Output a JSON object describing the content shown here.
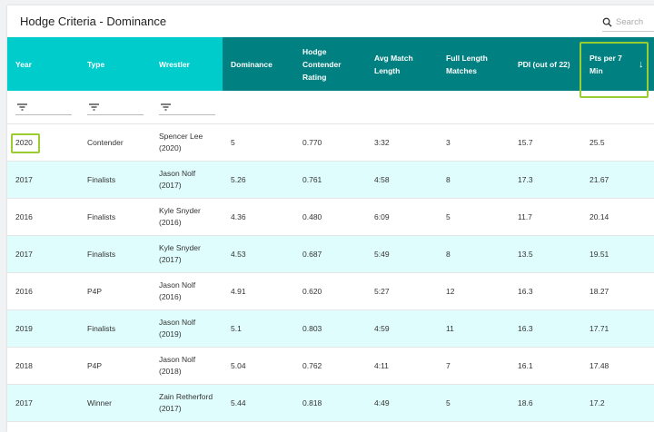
{
  "title": "Hodge Criteria - Dominance",
  "search_placeholder": "Search",
  "columns": [
    "Year",
    "Type",
    "Wrestler",
    "Dominance",
    "Hodge Contender Rating",
    "Avg Match Length",
    "Full Length Matches",
    "PDI (out of 22)",
    "Pts per 7 Min"
  ],
  "sort": {
    "column": "Pts per 7 Min",
    "direction": "descending"
  },
  "colors": {
    "light_header": "#00cccc",
    "dark_header": "#008080",
    "alt_row": "#e0fdfd",
    "highlight": "#9acd32"
  },
  "rows": [
    [
      "2020",
      "Contender",
      "Spencer Lee (2020)",
      "5",
      "0.770",
      "3:32",
      "3",
      "15.7",
      "25.5"
    ],
    [
      "2017",
      "Finalists",
      "Jason Nolf (2017)",
      "5.26",
      "0.761",
      "4:58",
      "8",
      "17.3",
      "21.67"
    ],
    [
      "2016",
      "Finalists",
      "Kyle Snyder (2016)",
      "4.36",
      "0.480",
      "6:09",
      "5",
      "11.7",
      "20.14"
    ],
    [
      "2017",
      "Finalists",
      "Kyle Snyder (2017)",
      "4.53",
      "0.687",
      "5:49",
      "8",
      "13.5",
      "19.51"
    ],
    [
      "2016",
      "P4P",
      "Jason Nolf (2016)",
      "4.91",
      "0.620",
      "5:27",
      "12",
      "16.3",
      "18.27"
    ],
    [
      "2019",
      "Finalists",
      "Jason Nolf (2019)",
      "5.1",
      "0.803",
      "4:59",
      "11",
      "16.3",
      "17.71"
    ],
    [
      "2018",
      "P4P",
      "Jason Nolf (2018)",
      "5.04",
      "0.762",
      "4:11",
      "7",
      "16.1",
      "17.48"
    ],
    [
      "2017",
      "Winner",
      "Zain Retherford (2017)",
      "5.44",
      "0.818",
      "4:49",
      "5",
      "18.6",
      "17.2"
    ]
  ]
}
